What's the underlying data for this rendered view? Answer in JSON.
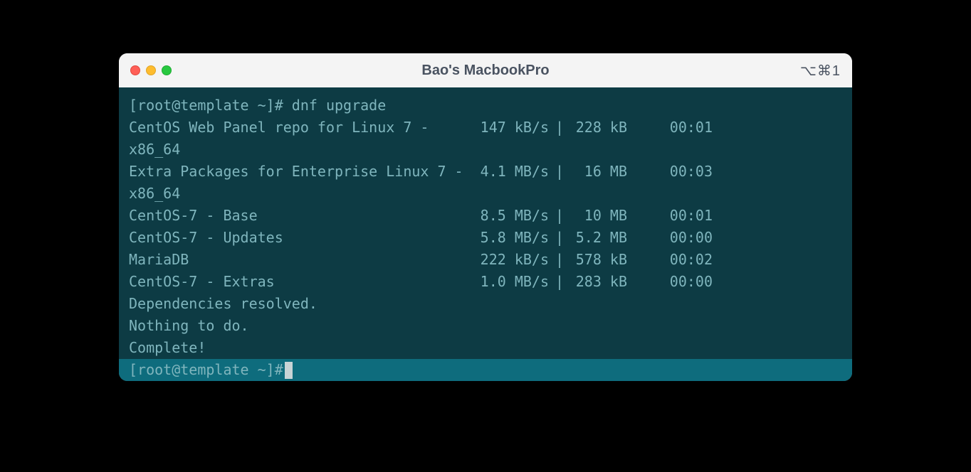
{
  "window": {
    "title": "Bao's MacbookPro",
    "shortcut": "⌥⌘1"
  },
  "terminal": {
    "prompt": "[root@template ~]# ",
    "command": "dnf upgrade",
    "repos": [
      {
        "name": "CentOS Web Panel repo for Linux 7 - x86_64",
        "speed": "147 kB/s",
        "size": "228 kB",
        "time": "00:01"
      },
      {
        "name": "Extra Packages for Enterprise Linux 7 - x86_64",
        "speed": "4.1 MB/s",
        "size": " 16 MB",
        "time": "00:03"
      },
      {
        "name": "CentOS-7 - Base",
        "speed": "8.5 MB/s",
        "size": " 10 MB",
        "time": "00:01"
      },
      {
        "name": "CentOS-7 - Updates",
        "speed": "5.8 MB/s",
        "size": "5.2 MB",
        "time": "00:00"
      },
      {
        "name": "MariaDB",
        "speed": "222 kB/s",
        "size": "578 kB",
        "time": "00:02"
      },
      {
        "name": "CentOS-7 - Extras",
        "speed": "1.0 MB/s",
        "size": "283 kB",
        "time": "00:00"
      }
    ],
    "messages": [
      "Dependencies resolved.",
      "Nothing to do.",
      "Complete!"
    ],
    "prompt2": "[root@template ~]# "
  }
}
